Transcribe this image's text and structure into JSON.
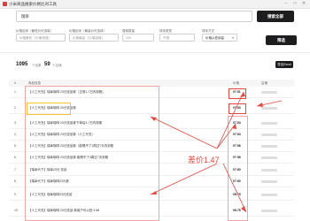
{
  "window": {
    "title": "小米商品搜索价格比对工具"
  },
  "search": {
    "value": "瑞幸",
    "button_label": "搜索全部"
  },
  "filters": [
    {
      "label": "价格区间（最低价可选填）",
      "placeholder": "价格最低（元/最低值）"
    },
    {
      "label": "价格区间（最高价可选填）",
      "placeholder": "价格最高（元/最高值）"
    },
    {
      "label": "搜索数量",
      "placeholder": "100"
    },
    {
      "label": "排序类型",
      "placeholder": "不限"
    },
    {
      "label": "排序方式",
      "value": "价格从低到高"
    }
  ],
  "filter_button": "筛选",
  "stats": {
    "total_count": "1095",
    "total_label": "个结果",
    "page_count": "59",
    "page_label": "个店铺"
  },
  "export_label": "导出Excel",
  "table": {
    "headers": [
      "#",
      "商品信息",
      "价格",
      "店铺"
    ],
    "rows": [
      {
        "index": "1",
        "name": "【人工代充】瑞幸咖啡 23元饮品券（正常1-7日内到账)",
        "price": "¥7.51"
      },
      {
        "index": "2",
        "name": "【人工代充】瑞幸咖啡 20元饮品券",
        "price": "¥7.53"
      },
      {
        "index": "3",
        "name": "【人工代充】瑞幸咖啡 23元饮品券下单后3-7日内到账",
        "price": "¥7.54"
      },
      {
        "index": "4",
        "name": "【人工代充】瑞幸咖啡 23元饮品券（人工代充）",
        "price": "¥7.54"
      },
      {
        "index": "5",
        "name": "【人工代充】瑞幸咖啡 23元饮品券（能喝不了1周过7天内到账",
        "price": "¥7.56"
      },
      {
        "index": "6",
        "name": "【人工代充】瑞幸咖啡 23元饮品券 能喝不了3周过7天到账",
        "price": "¥7.56"
      },
      {
        "index": "7",
        "name": "【瑞幸代下】瑞幸23元 饮品",
        "price": "¥7.60"
      },
      {
        "index": "8",
        "name": "【瑞幸代下】瑞幸咖啡23元券",
        "price": "¥7.60"
      },
      {
        "index": "9",
        "name": "【人工代充】瑞幸咖啡23元饮品",
        "price": "¥8.75"
      },
      {
        "index": "10",
        "name": "【人工代充】瑞幸咖啡 23元饮品 新用户可以拍 3.68",
        "price": "¥8.75"
      }
    ]
  },
  "annotation": "差价1.47",
  "colors": {
    "accent_dark": "#1d1d1f",
    "highlight_red": "#e5483f",
    "highlight_yellow": "#f3c330"
  }
}
